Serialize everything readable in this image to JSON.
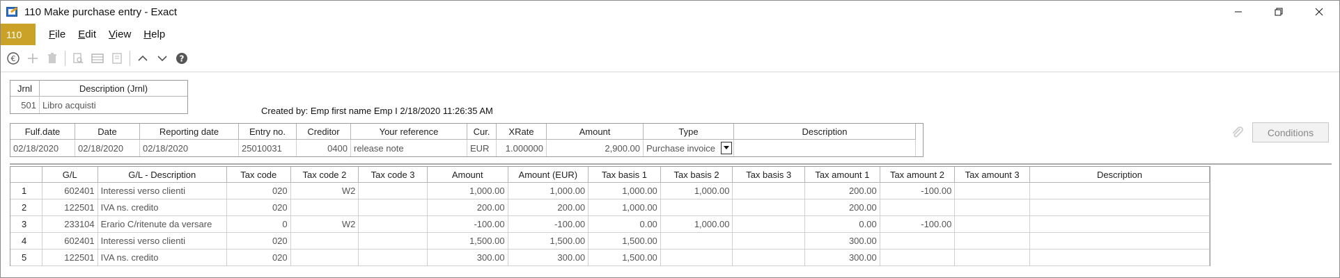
{
  "window": {
    "title": "110 Make purchase entry - Exact",
    "icons": {
      "app": "exact-app-icon",
      "minimize": "minimize-icon",
      "restore": "restore-icon",
      "close": "close-icon"
    }
  },
  "menubar": {
    "module_badge": "110",
    "items": [
      {
        "accel": "F",
        "rest": "ile"
      },
      {
        "accel": "E",
        "rest": "dit"
      },
      {
        "accel": "V",
        "rest": "iew"
      },
      {
        "accel": "H",
        "rest": "elp"
      }
    ]
  },
  "toolbar": {
    "icons": [
      "euro-icon",
      "add-icon",
      "delete-icon",
      "preview-icon",
      "list-icon",
      "notes-icon",
      "arrow-up-icon",
      "arrow-down-icon",
      "help-icon"
    ]
  },
  "journal": {
    "headers": [
      "Jrnl",
      "Description (Jrnl)"
    ],
    "code": "501",
    "description": "Libro acquisti"
  },
  "created_by": "Created by: Emp first name Emp I  2/18/2020 11:26:35 AM",
  "entry": {
    "headers": [
      "Fulf.date",
      "Date",
      "Reporting date",
      "Entry no.",
      "Creditor",
      "Your reference",
      "Cur.",
      "XRate",
      "Amount",
      "Type",
      "Description"
    ],
    "values": {
      "fulf_date": "02/18/2020",
      "date": "02/18/2020",
      "reporting_date": "02/18/2020",
      "entry_no": "25010031",
      "creditor": "0400",
      "your_reference": "release note",
      "currency": "EUR",
      "xrate": "1.000000",
      "amount": "2,900.00",
      "type": "Purchase invoice",
      "description": ""
    }
  },
  "conditions_label": "Conditions",
  "lines": {
    "headers": [
      "G/L",
      "G/L - Description",
      "Tax code",
      "Tax code 2",
      "Tax code 3",
      "Amount",
      "Amount (EUR)",
      "Tax basis 1",
      "Tax basis 2",
      "Tax basis 3",
      "Tax amount 1",
      "Tax amount 2",
      "Tax amount 3",
      "Description"
    ],
    "rows": [
      {
        "n": "1",
        "gl": "602401",
        "desc": "Interessi verso clienti",
        "tc1": "020",
        "tc2": "W2",
        "tc3": "",
        "amt": "1,000.00",
        "amt_eur": "1,000.00",
        "tb1": "1,000.00",
        "tb2": "1,000.00",
        "tb3": "",
        "ta1": "200.00",
        "ta2": "-100.00",
        "ta3": "",
        "d": ""
      },
      {
        "n": "2",
        "gl": "122501",
        "desc": "IVA ns. credito",
        "tc1": "020",
        "tc2": "",
        "tc3": "",
        "amt": "200.00",
        "amt_eur": "200.00",
        "tb1": "1,000.00",
        "tb2": "",
        "tb3": "",
        "ta1": "200.00",
        "ta2": "",
        "ta3": "",
        "d": ""
      },
      {
        "n": "3",
        "gl": "233104",
        "desc": "Erario C/ritenute da versare",
        "tc1": "0",
        "tc2": "W2",
        "tc3": "",
        "amt": "-100.00",
        "amt_eur": "-100.00",
        "tb1": "0.00",
        "tb2": "1,000.00",
        "tb3": "",
        "ta1": "0.00",
        "ta2": "-100.00",
        "ta3": "",
        "d": ""
      },
      {
        "n": "4",
        "gl": "602401",
        "desc": "Interessi verso clienti",
        "tc1": "020",
        "tc2": "",
        "tc3": "",
        "amt": "1,500.00",
        "amt_eur": "1,500.00",
        "tb1": "1,500.00",
        "tb2": "",
        "tb3": "",
        "ta1": "300.00",
        "ta2": "",
        "ta3": "",
        "d": ""
      },
      {
        "n": "5",
        "gl": "122501",
        "desc": "IVA ns. credito",
        "tc1": "020",
        "tc2": "",
        "tc3": "",
        "amt": "300.00",
        "amt_eur": "300.00",
        "tb1": "1,500.00",
        "tb2": "",
        "tb3": "",
        "ta1": "300.00",
        "ta2": "",
        "ta3": "",
        "d": ""
      }
    ]
  }
}
